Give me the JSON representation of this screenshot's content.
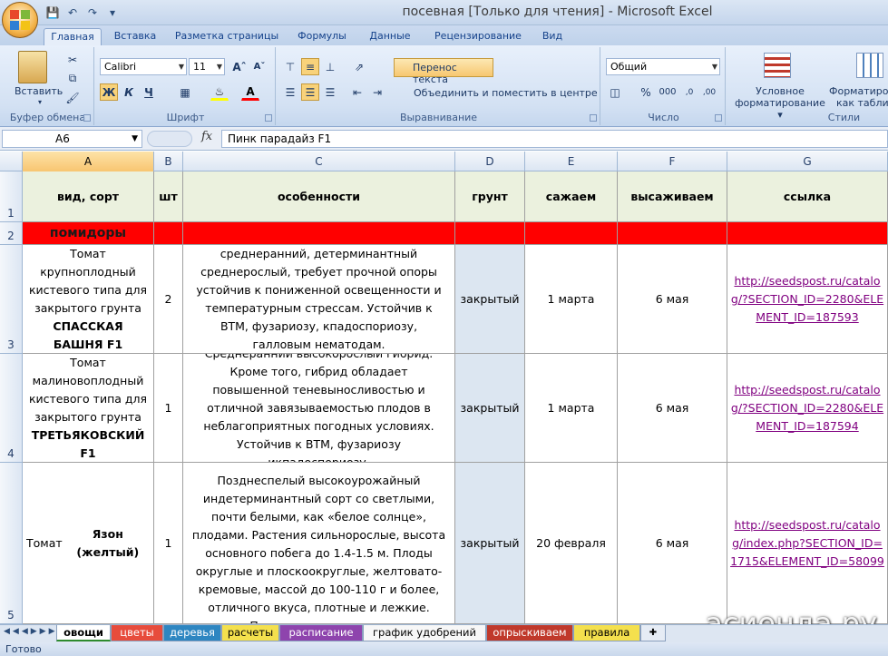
{
  "window": {
    "title": "посевная  [Только для чтения]  -  Microsoft Excel"
  },
  "tabs": [
    "Главная",
    "Вставка",
    "Разметка страницы",
    "Формулы",
    "Данные",
    "Рецензирование",
    "Вид"
  ],
  "ribbon": {
    "clipboard": {
      "paste_label": "Вставить",
      "group_label": "Буфер обмена"
    },
    "font": {
      "font_name": "Calibri",
      "font_size": "11",
      "bold": "Ж",
      "italic": "К",
      "underline": "Ч",
      "group_label": "Шрифт"
    },
    "alignment": {
      "wrap_text": "Перенос текста",
      "merge_center": "Объединить и поместить в центре",
      "group_label": "Выравнивание"
    },
    "number": {
      "format": "Общий",
      "percent": "%",
      "thousands": "000",
      "group_label": "Число"
    },
    "styles": {
      "conditional_formatting_1": "Условное",
      "conditional_formatting_2": "форматирование",
      "format_as_table_1": "Форматиро",
      "format_as_table_2": "как табли",
      "group_label": "Стили"
    }
  },
  "formula_bar": {
    "name_box": "A6",
    "fx": "fx",
    "formula": "Пинк парадайз F1"
  },
  "columns": [
    "A",
    "B",
    "C",
    "D",
    "E",
    "F",
    "G"
  ],
  "rows": {
    "header": {
      "num": "1",
      "cells": [
        "вид, сорт",
        "шт",
        "особенности",
        "грунт",
        "сажаем",
        "высаживаем",
        "ссылка"
      ]
    },
    "section": {
      "num": "2",
      "label": "помидоры"
    },
    "r3": {
      "num": "3",
      "a1": "Томат крупноплодный кистевого типа для закрытого грунта",
      "a2": "СПАССКАЯ БАШНЯ F1",
      "b": "2",
      "c": "среднеранний, детерминантный среднерослый, требует прочной опоры устойчив к пониженной освещенности и температурным стрессам. Устойчив к ВТМ, фузариозу, кпадоспориозу, галловым нематодам.",
      "d": "закрытый",
      "e": "1 марта",
      "f": "6 мая",
      "g": "http://seedspost.ru/catalog/?SECTION_ID=2280&ELEMENT_ID=187593"
    },
    "r4": {
      "num": "4",
      "a1": "Томат малиновоплодный кистевого типа для закрытого грунта",
      "a2": "ТРЕТЬЯКОВСКИЙ F1",
      "b": "1",
      "c": "Среднеранний высокорослый гибрид. Кроме того, гибрид обладает повышенной теневыносливостью и отличной завязываемостью плодов в неблагоприятных погодных условиях. Устойчив к ВТМ, фузариозу икпадоспориозу.",
      "d": "закрытый",
      "e": "1 марта",
      "f": "6 мая",
      "g": "http://seedspost.ru/catalog/?SECTION_ID=2280&ELEMENT_ID=187594"
    },
    "r5": {
      "num": "5",
      "a1": "Томат ",
      "a2": "Язон (желтый)",
      "b": "1",
      "c": "Позднеспелый высокоурожайный индетерминантный сорт со светлыми, почти белыми, как «белое солнце», плодами. Растения сильнорослые, высота основного побега до 1.4-1.5 м. Плоды округлые и плоскоокруглые, желтовато-кремовые, массой до 100-110 г и более, отличного вкуса, плотные и лежкие. Период плодоношения продолжительный, до самой осени. Один из",
      "d": "закрытый",
      "e": "20 февраля",
      "f": "6 мая",
      "g": "http://seedspost.ru/catalog/index.php?SECTION_ID=1715&ELEMENT_ID=58099"
    }
  },
  "sheets": [
    "овощи",
    "цветы",
    "деревья",
    "расчеты",
    "расписание",
    "график удобрений",
    "опрыскиваем",
    "правила"
  ],
  "status": "Готово",
  "watermark": "асиенда.ру",
  "colors": {
    "header_fill": "#ebf1de",
    "section_fill": "#ff0000",
    "grunt_fill": "#dce6f1",
    "link": "#800080"
  }
}
